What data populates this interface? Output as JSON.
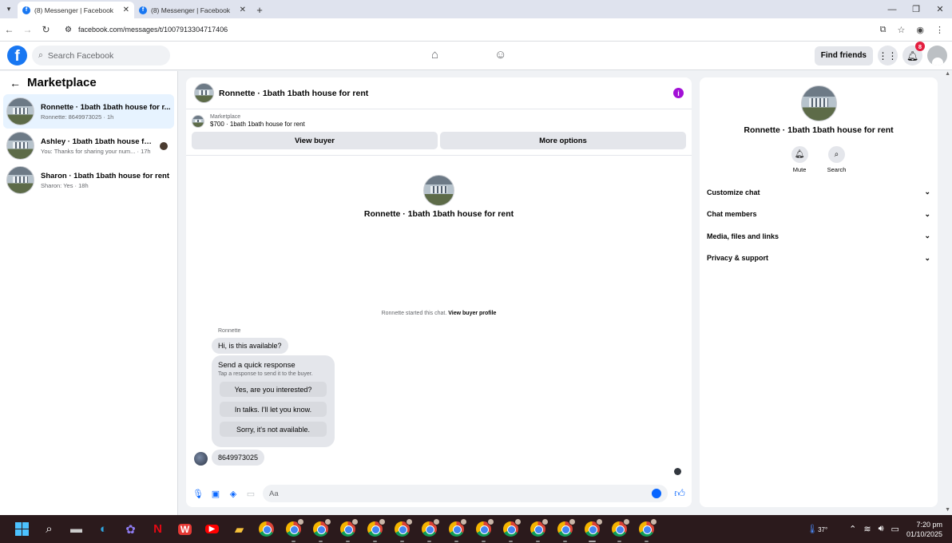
{
  "browser": {
    "tabs": [
      {
        "title": "(8) Messenger | Facebook",
        "active": true
      },
      {
        "title": "(8) Messenger | Facebook",
        "active": false
      }
    ],
    "url": "facebook.com/messages/t/1007913304717406"
  },
  "header": {
    "search_placeholder": "Search Facebook",
    "find_friends": "Find friends",
    "notifications_count": "8"
  },
  "sidebar": {
    "title": "Marketplace",
    "conversations": [
      {
        "name": "Ronnette · 1bath 1bath house for r...",
        "preview": "Ronnette: 8649973025 · 1h",
        "active": true
      },
      {
        "name": "Ashley · 1bath 1bath house for r...",
        "preview": "You: Thanks for sharing your num... · 17h",
        "active": false
      },
      {
        "name": "Sharon · 1bath 1bath house for rent",
        "preview": "Sharon: Yes · 18h",
        "active": false
      }
    ]
  },
  "chat": {
    "title": "Ronnette · 1bath 1bath house for rent",
    "marketplace_label": "Marketplace",
    "listing": "$700 · 1bath 1bath house for rent",
    "view_buyer": "View buyer",
    "more_options": "More options",
    "intro_name": "Ronnette · 1bath 1bath house for rent",
    "started_text": "Ronnette started this chat.",
    "view_buyer_profile": "View buyer profile",
    "sender": "Ronnette",
    "message1": "Hi, is this available?",
    "quick_title": "Send a quick response",
    "quick_sub": "Tap a response to send it to the buyer.",
    "quick_replies": [
      "Yes, are you interested?",
      "In talks. I'll let you know.",
      "Sorry, it's not available."
    ],
    "message2": "8649973025",
    "composer_placeholder": "Aa"
  },
  "info": {
    "name": "Ronnette · 1bath 1bath house for rent",
    "mute": "Mute",
    "search": "Search",
    "sections": [
      "Customize chat",
      "Chat members",
      "Media, files and links",
      "Privacy & support"
    ]
  },
  "taskbar": {
    "temperature": "37°",
    "time": "7:20 pm",
    "date": "01/10/2025"
  },
  "colors": {
    "brand": "#1877f2",
    "messenger_blue": "#0866ff",
    "info_purple": "#a210d6"
  }
}
